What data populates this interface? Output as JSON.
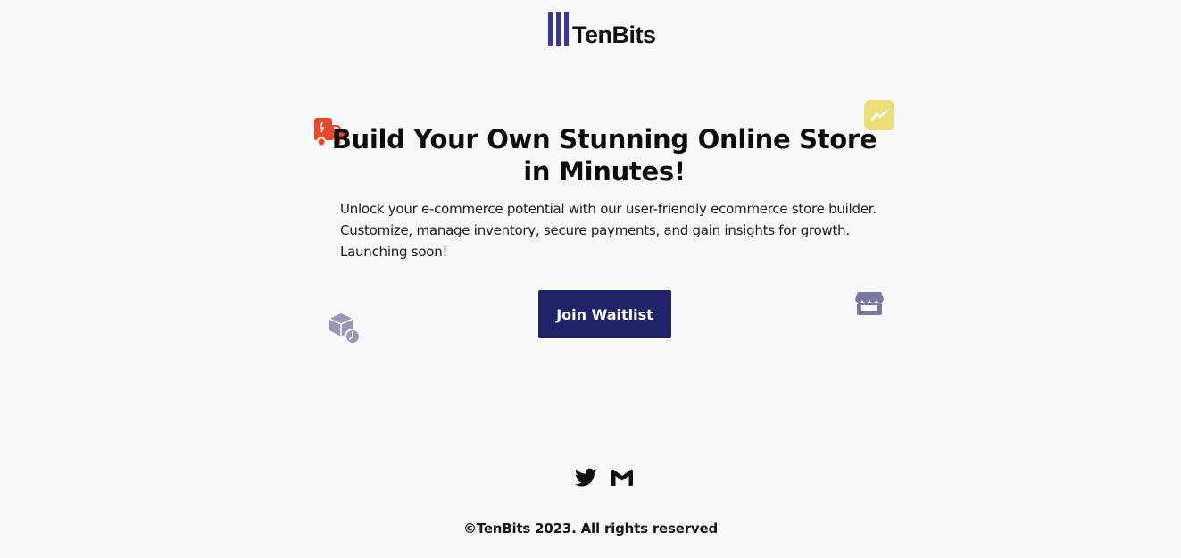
{
  "brand": {
    "name": "TenBits",
    "bar_color": "#3a339d"
  },
  "hero": {
    "headline_line1": "Build Your Own Stunning Online Store",
    "headline_line2": "in Minutes!",
    "description_lines": [
      "Unlock your e-commerce potential with our user-friendly ecommerce store builder.",
      "Customize, manage inventory, secure payments, and gain insights for growth.",
      "Launching soon!"
    ],
    "cta_label": "Join Waitlist",
    "cta_color": "#21236a"
  },
  "decorations": {
    "truck_icon_color": "#e9472b",
    "chart_icon_color": "#ebdf7a",
    "box_icon_color": "#9b97b3",
    "store_icon_color": "#7a77a3"
  },
  "footer": {
    "social": [
      "twitter-icon",
      "gmail-icon"
    ],
    "copyright": "©TenBits 2023. All rights reserved"
  }
}
